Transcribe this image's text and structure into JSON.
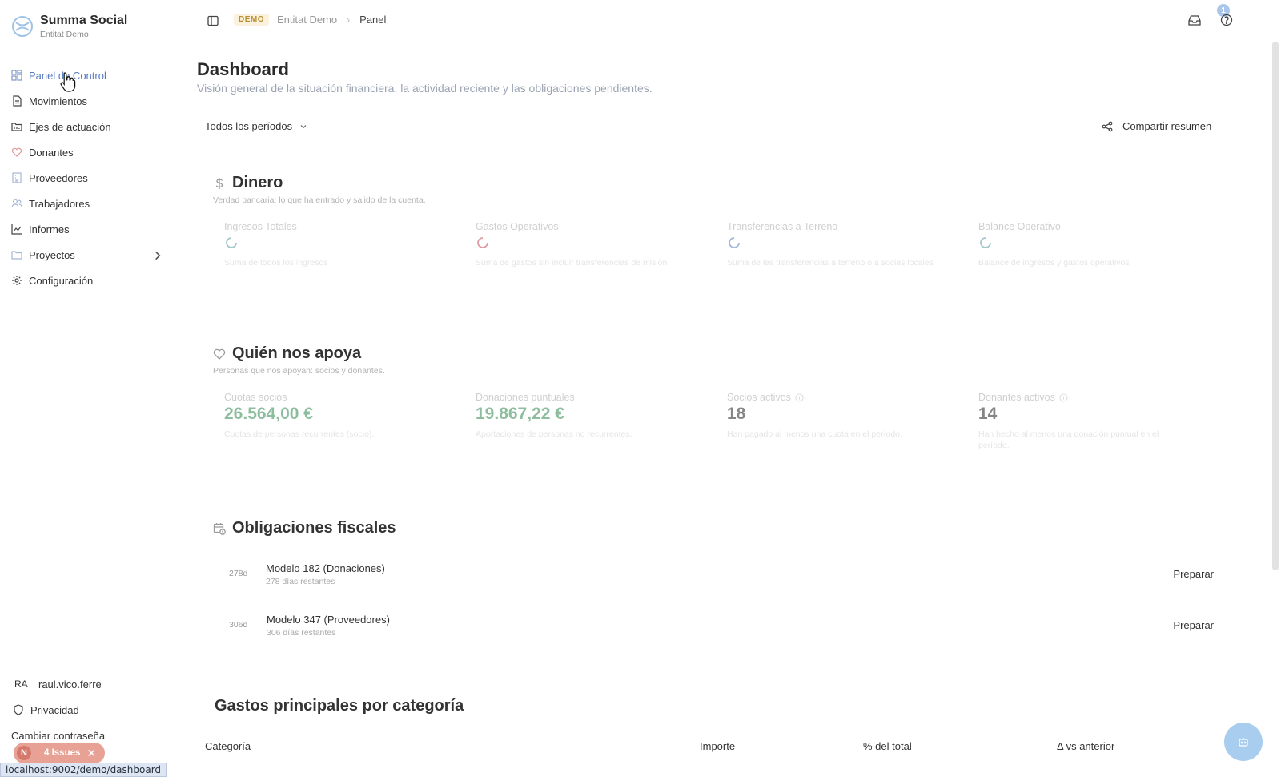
{
  "app": {
    "name": "Summa Social",
    "entity": "Entitat Demo"
  },
  "sidebar": {
    "items": [
      {
        "label": "Panel de Control",
        "icon": "dashboard-icon"
      },
      {
        "label": "Movimientos",
        "icon": "file-icon"
      },
      {
        "label": "Ejes de actuación",
        "icon": "folder-chart-icon"
      },
      {
        "label": "Donantes",
        "icon": "heart-icon"
      },
      {
        "label": "Proveedores",
        "icon": "building-icon"
      },
      {
        "label": "Trabajadores",
        "icon": "users-icon"
      },
      {
        "label": "Informes",
        "icon": "chart-icon"
      },
      {
        "label": "Proyectos",
        "icon": "folder-icon"
      },
      {
        "label": "Configuración",
        "icon": "gear-icon"
      }
    ],
    "user": {
      "initials": "RA",
      "name": "raul.vico.ferre"
    },
    "privacy": "Privacidad",
    "change_password": "Cambiar contraseña"
  },
  "header": {
    "badge": "DEMO",
    "crumb_entity": "Entitat Demo",
    "crumb_separator": "›",
    "crumb_page": "Panel",
    "notifications": "1"
  },
  "page": {
    "title": "Dashboard",
    "description": "Visión general de la situación financiera, la actividad reciente y las obligaciones pendientes.",
    "period": "Todos los períodos",
    "share": "Compartir resumen"
  },
  "money": {
    "title": "Dinero",
    "description": "Verdad bancaria: lo que ha entrado y salido de la cuenta.",
    "cards": [
      {
        "label": "Ingresos Totales",
        "note": "Suma de todos los ingresos",
        "spinner_color": "#5b9aa0"
      },
      {
        "label": "Gastos Operativos",
        "note": "Suma de gastos sin incluir transferencias de misión",
        "spinner_color": "#c64a5a"
      },
      {
        "label": "Transferencias a Terreno",
        "note": "Suma de las transferencias a terreno o a socias locales",
        "spinner_color": "#5b7fc0"
      },
      {
        "label": "Balance Operativo",
        "note": "Balance de ingresos y gastos operativos",
        "spinner_color": "#5b9aa0"
      }
    ]
  },
  "supporters": {
    "title": "Quién nos apoya",
    "description": "Personas que nos apoyan: socios y donantes.",
    "cards": [
      {
        "label": "Cuotas socios",
        "value": "26.564,00 €",
        "note": "Cuotas de personas recurrentes (socio).",
        "color": "#2f8a4f"
      },
      {
        "label": "Donaciones puntuales",
        "value": "19.867,22 €",
        "note": "Aportaciones de personas no recurrentes.",
        "color": "#2f8a4f"
      },
      {
        "label": "Socios activos",
        "value": "18",
        "note": "Han pagado al menos una cuota en el período.",
        "color": "#222222"
      },
      {
        "label": "Donantes activos",
        "value": "14",
        "note": "Han hecho al menos una donación puntual en el período.",
        "color": "#222222"
      }
    ]
  },
  "fiscal": {
    "title": "Obligaciones fiscales",
    "items": [
      {
        "days": "278d",
        "name": "Modelo 182 (Donaciones)",
        "remaining": "278 días restantes",
        "action": "Preparar"
      },
      {
        "days": "306d",
        "name": "Modelo 347 (Proveedores)",
        "remaining": "306 días restantes",
        "action": "Preparar"
      }
    ]
  },
  "expenses": {
    "title": "Gastos principales por categoría",
    "columns": [
      "Categoría",
      "Importe",
      "% del total",
      "Δ vs anterior"
    ]
  },
  "issues": {
    "letter": "N",
    "label": "4 Issues",
    "close": "✕"
  },
  "status_url": "localhost:9002/demo/dashboard"
}
